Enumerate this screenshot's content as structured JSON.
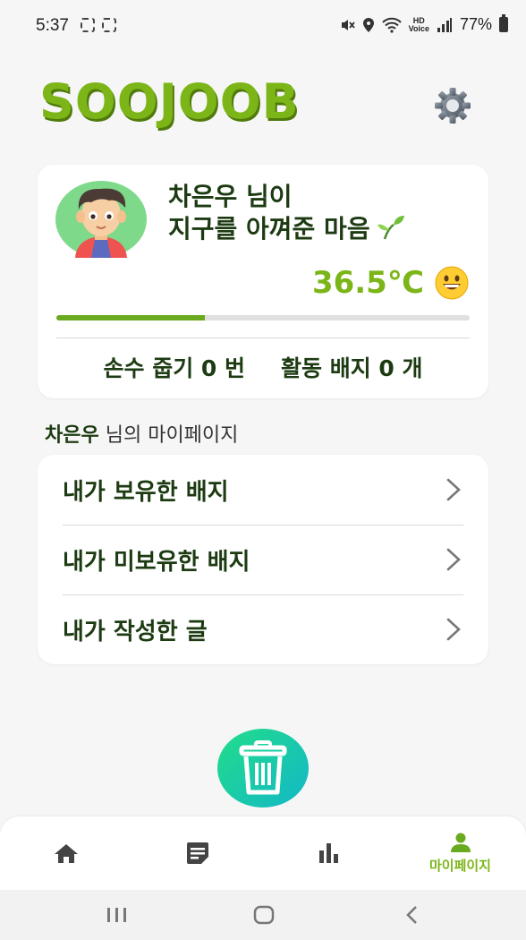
{
  "status_bar": {
    "time": "5:37",
    "battery": "77%",
    "network_label": "HD\nVoice"
  },
  "header": {
    "logo_text": "SOOJOOB",
    "settings_icon": "gear-icon"
  },
  "profile": {
    "greeting_line1": "차은우 님이",
    "greeting_line2": "지구를 아껴준 마음",
    "temperature": "36.5℃",
    "progress": 0.36,
    "stats": {
      "pickups": "손수 줍기 0 번",
      "badges": "활동 배지 0 개"
    }
  },
  "section": {
    "name": "차은우",
    "suffix": " 님의 마이페이지"
  },
  "menu": {
    "items": [
      {
        "label": "내가 보유한 배지"
      },
      {
        "label": "내가 미보유한 배지"
      },
      {
        "label": "내가 작성한 글"
      }
    ]
  },
  "bottom_nav": {
    "items": [
      {
        "icon": "home-icon"
      },
      {
        "icon": "document-icon"
      },
      {
        "icon": "bar-chart-icon"
      },
      {
        "icon": "person-icon",
        "label": "마이페이지",
        "active": true
      }
    ],
    "active_color": "#7cb518"
  },
  "colors": {
    "brand_green": "#7cb518",
    "dark_text": "#1d3b12",
    "fab_gradient_start": "#22dd88",
    "fab_gradient_end": "#12b8c8"
  }
}
